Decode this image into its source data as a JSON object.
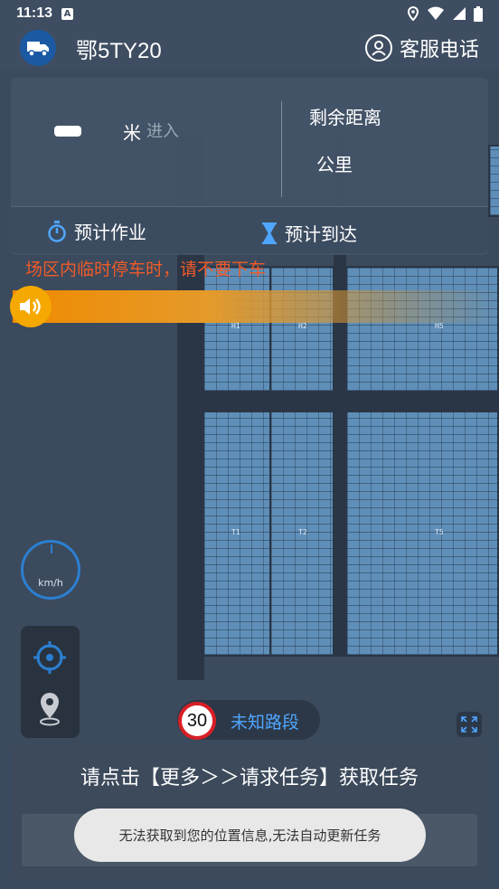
{
  "status_bar": {
    "time": "11:13",
    "notification_icon": "a-icon"
  },
  "header": {
    "plate": "鄂5TY20",
    "support_label": "客服电话"
  },
  "nav_panel": {
    "meter_unit": "米",
    "enter_label": "进入",
    "remaining_label": "剩余距离",
    "remaining_unit": "公里",
    "eta_work_label": "预计作业",
    "eta_arrive_label": "预计到达"
  },
  "warning_text": "场区内临时停车时，请不要下车",
  "map": {
    "zones": [
      "H1",
      "H2",
      "H5",
      "T1",
      "T2",
      "T5"
    ]
  },
  "speedometer": {
    "unit": "km/h"
  },
  "speed_limit": "30",
  "road_name": "未知路段",
  "task": {
    "prompt": "请点击【更多＞＞请求任务】获取任务"
  },
  "toast": "无法获取到您的位置信息,无法自动更新任务",
  "colors": {
    "accent_blue": "#2b7fd1",
    "warning_orange": "#f05a28",
    "speed_limit_red": "#d81f26",
    "audio_orange": "#f08a00"
  }
}
